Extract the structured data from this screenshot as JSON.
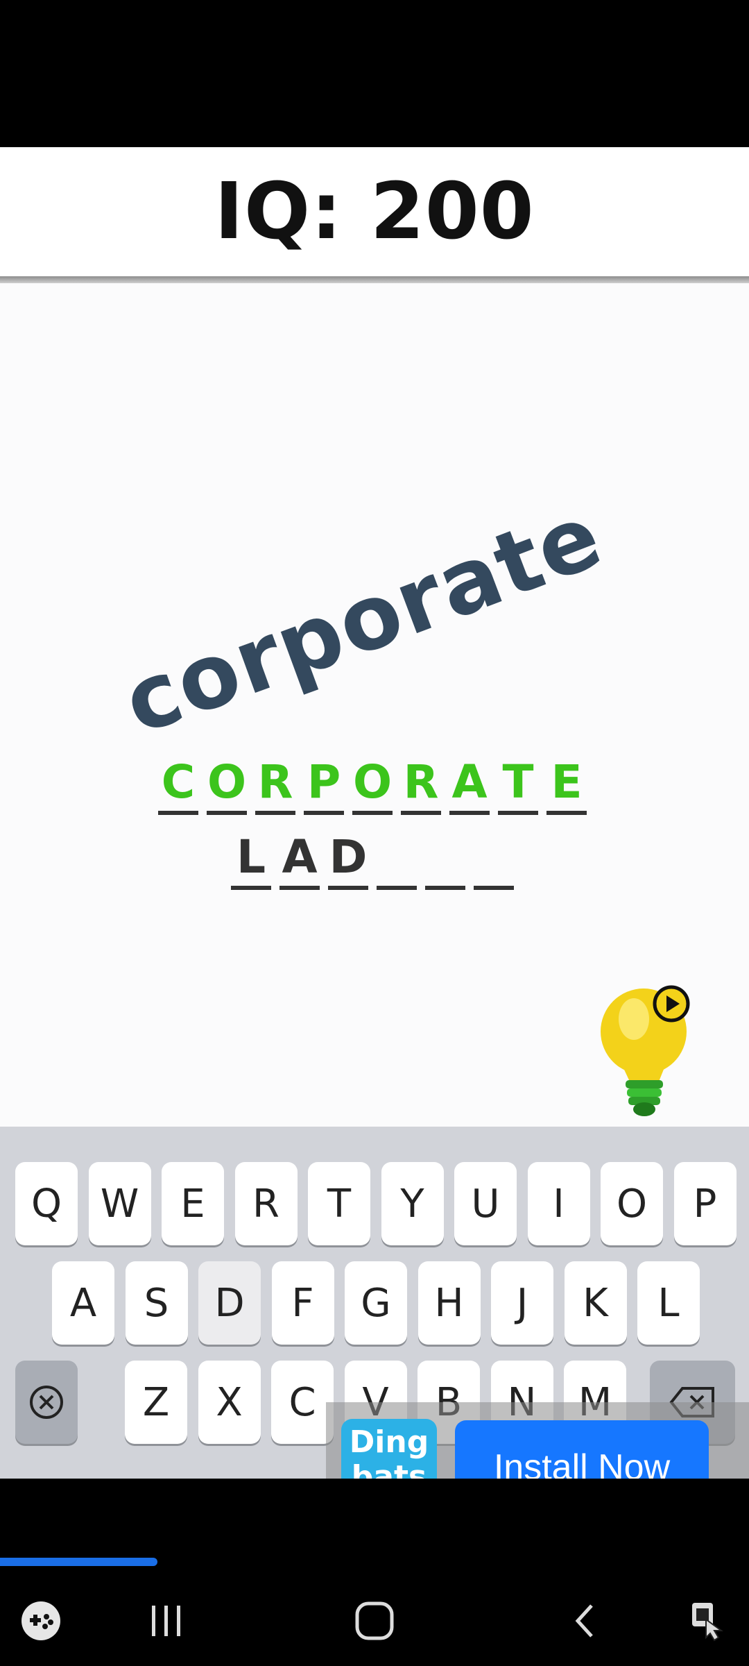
{
  "header": {
    "iq_label": "IQ: 200"
  },
  "puzzle": {
    "display_word": "corporate",
    "word_color": "#34495e",
    "answer_row1": [
      "C",
      "O",
      "R",
      "P",
      "O",
      "R",
      "A",
      "T",
      "E"
    ],
    "answer_row2": [
      "L",
      "A",
      "D",
      "",
      "",
      ""
    ]
  },
  "colors": {
    "correct": "#3cc41c",
    "typed": "#333333",
    "install_button": "#1677ff"
  },
  "hint": {
    "icon": "lightbulb-play-icon"
  },
  "keyboard": {
    "row1": [
      "Q",
      "W",
      "E",
      "R",
      "T",
      "Y",
      "U",
      "I",
      "O",
      "P"
    ],
    "row2": [
      "A",
      "S",
      "D",
      "F",
      "G",
      "H",
      "J",
      "K",
      "L"
    ],
    "row3": [
      "Z",
      "X",
      "C",
      "V",
      "B",
      "N",
      "M"
    ],
    "pressed_key": "D",
    "left_func_icon": "clear-circle-icon",
    "right_func_icon": "backspace-icon"
  },
  "ad": {
    "logo_line1": "Ding",
    "logo_line2": "bats",
    "install_label": "Install Now"
  },
  "progress_fraction": 0.21,
  "navbar": {
    "icons": [
      "game-launcher-icon",
      "recents-icon",
      "home-icon",
      "back-icon",
      "accessibility-icon"
    ]
  }
}
